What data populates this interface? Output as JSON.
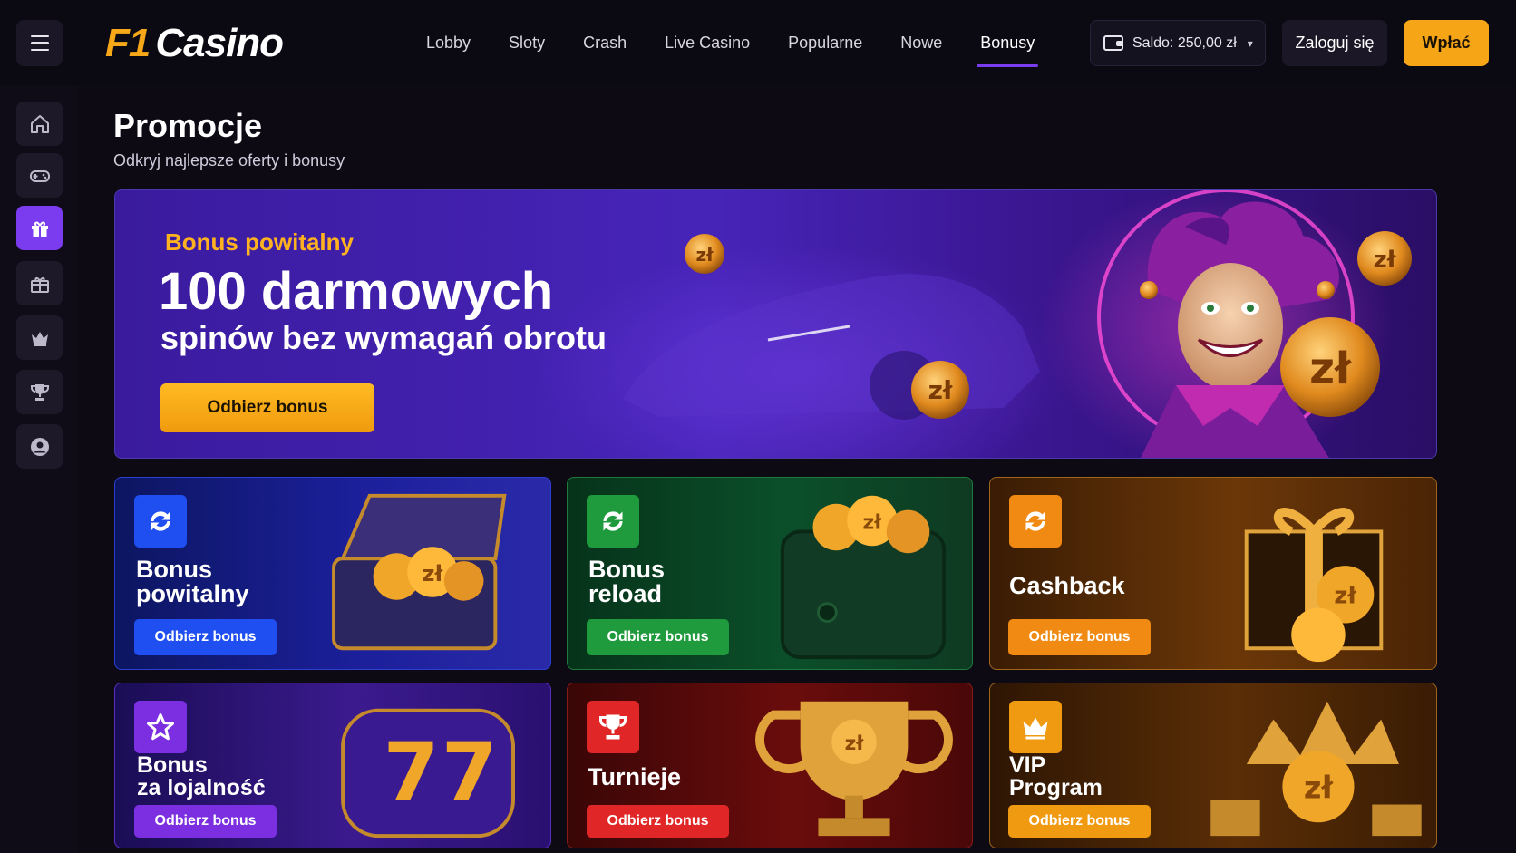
{
  "header": {
    "logo_f1": "F1",
    "logo_casino": "Casino",
    "nav": [
      "Lobby",
      "Sloty",
      "Crash",
      "Live Casino",
      "Popularne",
      "Nowe",
      "Bonusy"
    ],
    "active_nav": "Bonusy",
    "balance_label": "Saldo: 250,00 zł",
    "login_label": "Zaloguj się",
    "deposit_label": "Wpłać"
  },
  "sidebar": {
    "items": [
      "home-icon",
      "gamepad-icon",
      "gift-icon",
      "gift-box-icon",
      "crown-icon",
      "trophy-icon",
      "user-icon"
    ],
    "active": "gift-icon"
  },
  "page": {
    "title": "Promocje",
    "subtitle": "Odkryj najlepsze oferty i bonusy"
  },
  "hero": {
    "kicker": "Bonus powitalny",
    "title": "100 darmowych",
    "subtitle": "spinów bez wymagań obrotu",
    "button": "Odbierz bonus"
  },
  "cards": [
    {
      "title_line1": "Bonus",
      "title_line2": "powitalny",
      "button": "Odbierz bonus",
      "color": "#1f4ff0",
      "icon": "refresh-icon"
    },
    {
      "title_line1": "Bonus",
      "title_line2": "reload",
      "button": "Odbierz bonus",
      "color": "#1f9a3c",
      "icon": "refresh-icon"
    },
    {
      "title_line1": "Cashback",
      "title_line2": "",
      "button": "Odbierz bonus",
      "color": "#f08a12",
      "icon": "refresh-icon"
    },
    {
      "title_line1": "Bonus",
      "title_line2": "za lojalność",
      "button": "Odbierz bonus",
      "color": "#7b2fe0",
      "icon": "star-icon"
    },
    {
      "title_line1": "Turnieje",
      "title_line2": "",
      "button": "Odbierz bonus",
      "color": "#e02626",
      "icon": "trophy-icon"
    },
    {
      "title_line1": "VIP",
      "title_line2": "Program",
      "button": "Odbierz bonus",
      "color": "#f09a12",
      "icon": "crown-icon"
    }
  ]
}
